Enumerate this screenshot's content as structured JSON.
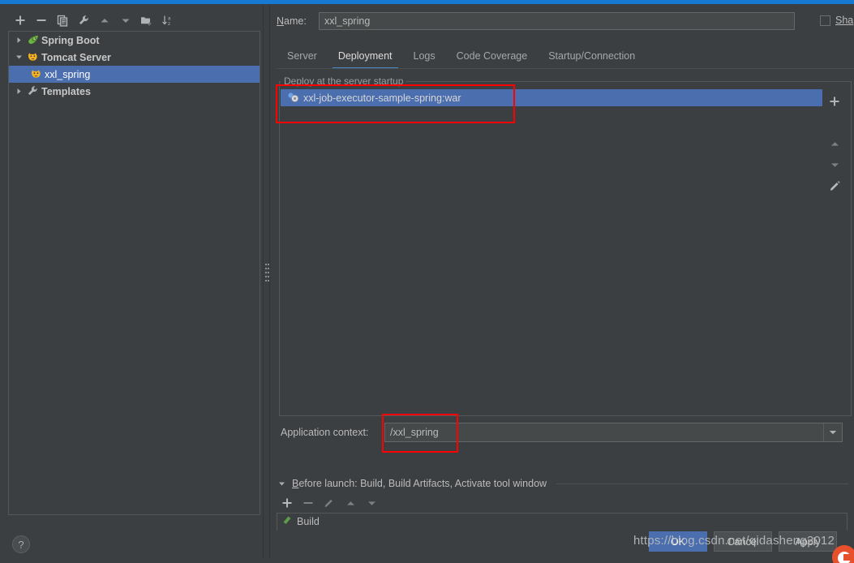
{
  "window": {
    "accent_color": "#1679d2",
    "background_color": "#3c3f41",
    "selection_color": "#4b6eaf",
    "annotation_color": "#ff0000"
  },
  "left_panel": {
    "toolbar": [
      {
        "name": "add-configuration-button",
        "icon": "plus-icon",
        "label": "+"
      },
      {
        "name": "remove-configuration-button",
        "icon": "minus-icon",
        "label": "−"
      },
      {
        "name": "copy-configuration-button",
        "icon": "copy-icon",
        "label": "Copy"
      },
      {
        "name": "edit-templates-button",
        "icon": "wrench-icon",
        "label": "Edit defaults"
      },
      {
        "name": "move-up-button",
        "icon": "arrow-up-icon",
        "label": "Move Up"
      },
      {
        "name": "move-down-button",
        "icon": "arrow-down-icon",
        "label": "Move Down"
      },
      {
        "name": "new-folder-button",
        "icon": "folder-add-icon",
        "label": "New Folder"
      },
      {
        "name": "sort-button",
        "icon": "sort-az-icon",
        "label": "Sort Configurations"
      }
    ],
    "tree": [
      {
        "label": "Spring Boot",
        "icon": "spring-boot-icon",
        "expanded": false,
        "selected": false,
        "bold": true,
        "child": false
      },
      {
        "label": "Tomcat Server",
        "icon": "tomcat-icon",
        "expanded": true,
        "selected": false,
        "bold": true,
        "child": false
      },
      {
        "label": "xxl_spring",
        "icon": "tomcat-icon",
        "expanded": null,
        "selected": true,
        "bold": false,
        "child": true
      },
      {
        "label": "Templates",
        "icon": "wrench-icon",
        "expanded": false,
        "selected": false,
        "bold": true,
        "child": false
      }
    ],
    "help_button_label": "?"
  },
  "right_panel": {
    "name_label": "Name:",
    "name_value": "xxl_spring",
    "share_label": "Sha",
    "share_checked": false,
    "tabs": [
      {
        "label": "Server",
        "active": false
      },
      {
        "label": "Deployment",
        "active": true
      },
      {
        "label": "Logs",
        "active": false
      },
      {
        "label": "Code Coverage",
        "active": false
      },
      {
        "label": "Startup/Connection",
        "active": false
      }
    ],
    "deployment": {
      "group_title": "Deploy at the server startup",
      "artifacts": [
        {
          "label": "xxl-job-executor-sample-spring:war",
          "icon": "artifact-icon",
          "selected": true
        }
      ],
      "list_toolbar": [
        {
          "name": "add-artifact-button",
          "icon": "plus-icon",
          "label": "+"
        },
        {
          "name": "remove-artifact-button",
          "icon": "minus-icon",
          "label": "−"
        },
        {
          "name": "move-artifact-up-button",
          "icon": "arrow-up-icon",
          "label": "Move Up"
        },
        {
          "name": "move-artifact-down-button",
          "icon": "arrow-down-icon",
          "label": "Move Down"
        },
        {
          "name": "edit-artifact-button",
          "icon": "pencil-icon",
          "label": "Edit"
        }
      ],
      "application_context_label": "Application context:",
      "application_context_value": "/xxl_spring"
    },
    "before_launch": {
      "title": "Before launch: Build, Build Artifacts, Activate tool window",
      "toolbar": [
        {
          "name": "add-task-button",
          "icon": "plus-icon",
          "label": "+"
        },
        {
          "name": "remove-task-button",
          "icon": "minus-icon",
          "label": "−"
        },
        {
          "name": "edit-task-button",
          "icon": "pencil-icon",
          "label": "Edit"
        },
        {
          "name": "task-move-up-button",
          "icon": "arrow-up-icon",
          "label": "Move Up"
        },
        {
          "name": "task-move-down-button",
          "icon": "arrow-down-icon",
          "label": "Move Down"
        }
      ],
      "tasks": [
        {
          "label": "Build",
          "icon": "build-hammer-icon"
        }
      ]
    },
    "dialog_buttons": [
      {
        "label": "OK",
        "primary": true
      },
      {
        "label": "Cancel",
        "primary": false
      },
      {
        "label": "Apply",
        "primary": false
      }
    ]
  },
  "watermark": {
    "text": "https://blog.csdn.net/qidasheng2012",
    "logo": "csdn-logo"
  }
}
